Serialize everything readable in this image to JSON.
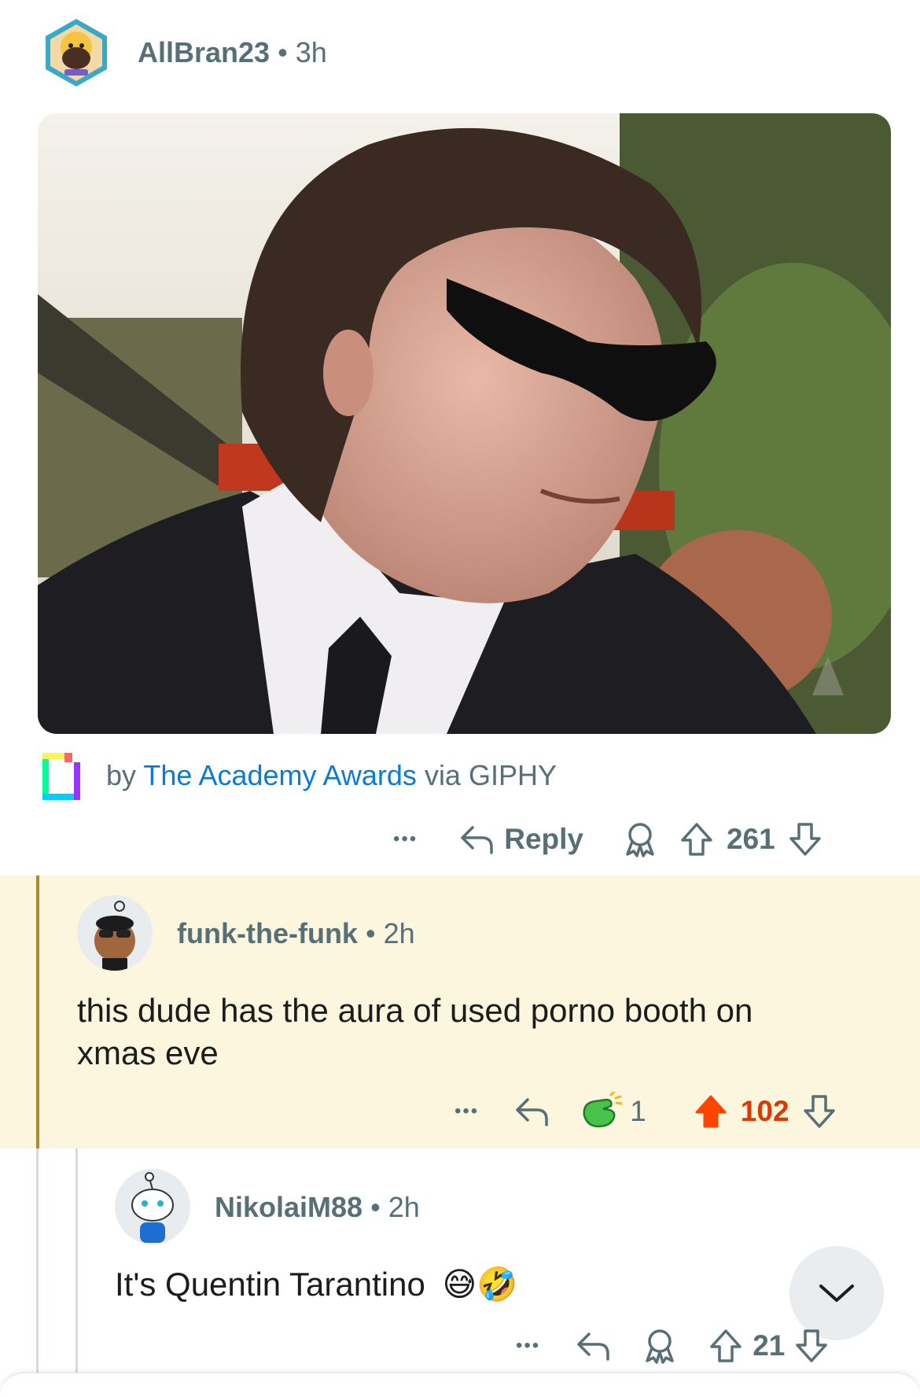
{
  "comment1": {
    "username": "AllBran23",
    "separator": "•",
    "time": "3h",
    "gif": {
      "attribution_prefix": "by",
      "attribution_source": "The Academy Awards",
      "attribution_suffix": "via GIPHY"
    },
    "actions": {
      "more": "•••",
      "reply_label": "Reply",
      "score": "261"
    }
  },
  "comment2": {
    "username": "funk-the-funk",
    "separator": "•",
    "time": "2h",
    "body_line1": "this dude has the aura of used porno booth on",
    "body_line2": "xmas eve",
    "actions": {
      "more": "•••",
      "award_count": "1",
      "score": "102"
    }
  },
  "comment3": {
    "username": "NikolaiM88",
    "separator": "•",
    "time": "2h",
    "body": "It's Quentin Tarantino",
    "emojis": "😅🤣",
    "actions": {
      "more": "•••",
      "score": "21"
    }
  },
  "colors": {
    "highlight_bg": "#fdf6df",
    "link_blue": "#0a7bd6",
    "upvote_orange": "#ff4500",
    "upvoted_score": "#d93a00",
    "meta_gray": "#576f76"
  }
}
